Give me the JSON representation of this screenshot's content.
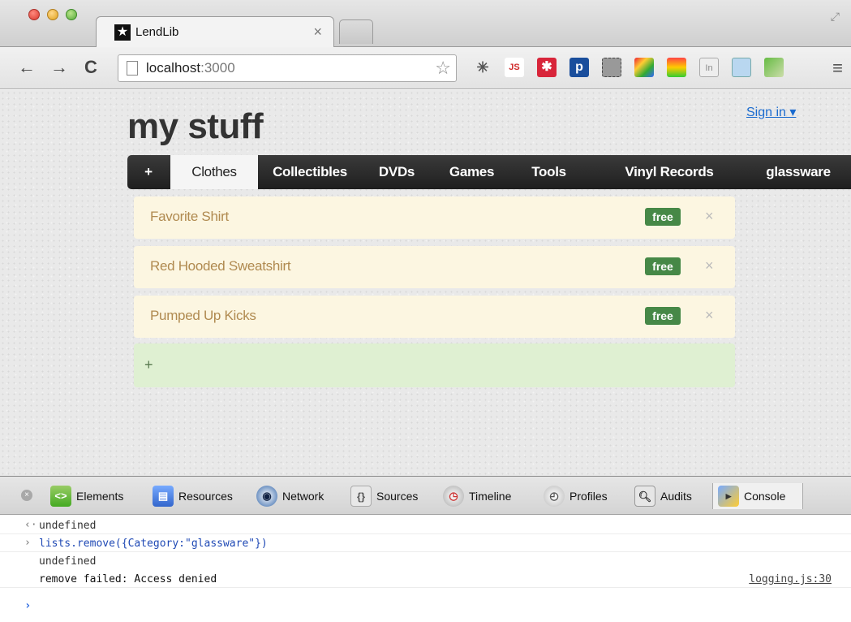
{
  "browser": {
    "tab_title": "LendLib",
    "tab_close": "×",
    "url_host": "localhost",
    "url_port": ":3000",
    "extensions": [
      "JS",
      "✱",
      "p",
      "In"
    ]
  },
  "page": {
    "brand": "my stuff",
    "signin": "Sign in ▾",
    "nav": [
      "+",
      "Clothes",
      "Collectibles",
      "DVDs",
      "Games",
      "Tools",
      "Vinyl Records",
      "glassware"
    ],
    "active_nav": "Clothes",
    "items": [
      {
        "name": "Favorite Shirt",
        "badge": "free"
      },
      {
        "name": "Red Hooded Sweatshirt",
        "badge": "free"
      },
      {
        "name": "Pumped Up Kicks",
        "badge": "free"
      }
    ],
    "item_close": "×",
    "add_plus": "+"
  },
  "devtools": {
    "tabs": [
      "Elements",
      "Resources",
      "Network",
      "Sources",
      "Timeline",
      "Profiles",
      "Audits",
      "Console"
    ],
    "active_tab": "Console",
    "console": [
      {
        "glyph": "‹·",
        "text": "undefined"
      },
      {
        "glyph": "›",
        "text": "lists.remove({Category:\"glassware\"})"
      },
      {
        "glyph": "",
        "text": "undefined"
      },
      {
        "glyph": "",
        "text": "remove failed: Access denied",
        "source": "logging.js:30"
      }
    ],
    "prompt": "›"
  },
  "colors": {
    "item_bg": "#fcf6e1",
    "item_text": "#b08a50",
    "badge": "#468847",
    "add_row": "#dff0d2",
    "navbar": "#222222",
    "link": "#1a6bcf"
  }
}
